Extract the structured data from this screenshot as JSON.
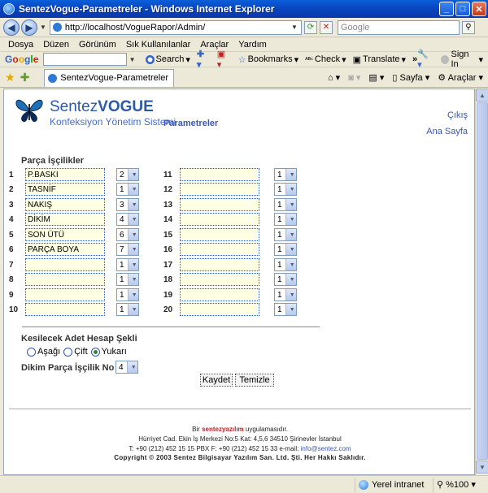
{
  "window": {
    "title": "SentezVogue-Parametreler - Windows Internet Explorer"
  },
  "address": {
    "url": "http://localhost/VogueRapor/Admin/",
    "search_placeholder": "Google"
  },
  "menu": [
    "Dosya",
    "Düzen",
    "Görünüm",
    "Sık Kullanılanlar",
    "Araçlar",
    "Yardım"
  ],
  "google_toolbar": {
    "search_label": "Search",
    "bookmarks": "Bookmarks",
    "check": "Check",
    "translate": "Translate",
    "more": "»",
    "signin": "Sign In"
  },
  "tab": {
    "title": "SentezVogue-Parametreler",
    "page_menu": "Sayfa",
    "tools_menu": "Araçlar"
  },
  "page": {
    "brand_regular": "Sentez",
    "brand_bold": "VOGUE",
    "tagline": "Konfeksiyon Yönetim Sistemi",
    "title": "Parametreler",
    "logout": "Çıkış",
    "home": "Ana Sayfa"
  },
  "form": {
    "section_title": "Parça İşçilikler",
    "left_rows": [
      {
        "no": "1",
        "name": "P.BASKI",
        "value": "2"
      },
      {
        "no": "2",
        "name": "TASNİF",
        "value": "1"
      },
      {
        "no": "3",
        "name": "NAKIŞ",
        "value": "3"
      },
      {
        "no": "4",
        "name": "DİKİM",
        "value": "4"
      },
      {
        "no": "5",
        "name": "SON ÜTÜ",
        "value": "6"
      },
      {
        "no": "6",
        "name": "PARÇA BOYA",
        "value": "7"
      },
      {
        "no": "7",
        "name": "",
        "value": "1"
      },
      {
        "no": "8",
        "name": "",
        "value": "1"
      },
      {
        "no": "9",
        "name": "",
        "value": "1"
      },
      {
        "no": "10",
        "name": "",
        "value": "1"
      }
    ],
    "right_rows": [
      {
        "no": "11",
        "name": "",
        "value": "1"
      },
      {
        "no": "12",
        "name": "",
        "value": "1"
      },
      {
        "no": "13",
        "name": "",
        "value": "1"
      },
      {
        "no": "14",
        "name": "",
        "value": "1"
      },
      {
        "no": "15",
        "name": "",
        "value": "1"
      },
      {
        "no": "16",
        "name": "",
        "value": "1"
      },
      {
        "no": "17",
        "name": "",
        "value": "1"
      },
      {
        "no": "18",
        "name": "",
        "value": "1"
      },
      {
        "no": "19",
        "name": "",
        "value": "1"
      },
      {
        "no": "20",
        "name": "",
        "value": "1"
      }
    ],
    "cut_title": "Kesilecek Adet Hesap Şekli",
    "radios": [
      {
        "label": "Aşağı",
        "checked": false
      },
      {
        "label": "Çift",
        "checked": false
      },
      {
        "label": "Yukarı",
        "checked": true
      }
    ],
    "dikim_label": "Dikim Parça İşçilik No",
    "dikim_value": "4",
    "save": "Kaydet",
    "clear": "Temizle"
  },
  "footer": {
    "line1_pre": "Bir",
    "line1_brand": "sentezyazılım",
    "line1_post": "uygulamasıdır.",
    "address": "Hürriyet Cad. Ekin İş Merkezi No:5 Kat: 4,5,6 34510 Şirinevler İstanbul",
    "phone": "T: +90 (212) 452 15 15 PBX F: +90 (212) 452 15 33 e-mail:",
    "email": "info@sentez.com",
    "copyright": "Copyright © 2003  Sentez Bilgisayar Yazılım San. Ltd. Şti. Her Hakkı Saklıdır."
  },
  "status": {
    "zone": "Yerel intranet",
    "zoom": "%100"
  }
}
